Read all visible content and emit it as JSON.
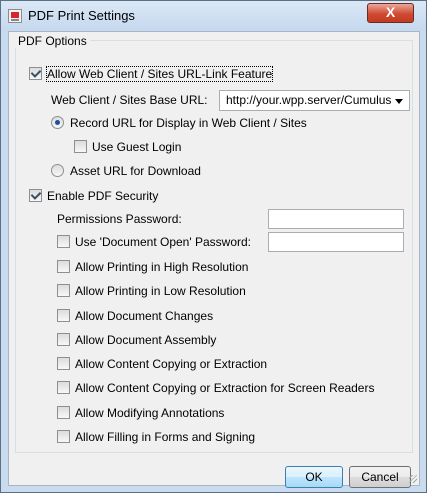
{
  "window": {
    "title": "PDF Print Settings",
    "close_label": "X"
  },
  "group": {
    "title": "PDF Options"
  },
  "web_link": {
    "enable_label": "Allow Web Client / Sites URL-Link Feature",
    "enable_checked": true,
    "base_url_label": "Web Client / Sites Base URL:",
    "base_url_value": "http://your.wpp.server/Cumulus",
    "record_url_label": "Record URL for Display in Web Client / Sites",
    "record_url_selected": true,
    "guest_login_label": "Use Guest Login",
    "guest_login_checked": false,
    "asset_url_label": "Asset URL for Download",
    "asset_url_selected": false
  },
  "security": {
    "enable_label": "Enable PDF Security",
    "enable_checked": true,
    "permissions_password_label": "Permissions Password:",
    "permissions_password_value": "",
    "open_password_label": "Use 'Document Open' Password:",
    "open_password_value": "",
    "options": [
      {
        "label": "Allow Printing in High Resolution",
        "checked": false
      },
      {
        "label": "Allow Printing in Low Resolution",
        "checked": false
      },
      {
        "label": "Allow Document Changes",
        "checked": false
      },
      {
        "label": "Allow Document Assembly",
        "checked": false
      },
      {
        "label": "Allow Content Copying or Extraction",
        "checked": false
      },
      {
        "label": "Allow Content Copying or Extraction for Screen Readers",
        "checked": false
      },
      {
        "label": "Allow Modifying Annotations",
        "checked": false
      },
      {
        "label": "Allow Filling in Forms and Signing",
        "checked": false
      }
    ]
  },
  "buttons": {
    "ok_label": "OK",
    "cancel_label": "Cancel"
  },
  "icons": {
    "app": "pdf-settings-icon",
    "close": "close-icon",
    "dropdown": "chevron-down-icon"
  }
}
